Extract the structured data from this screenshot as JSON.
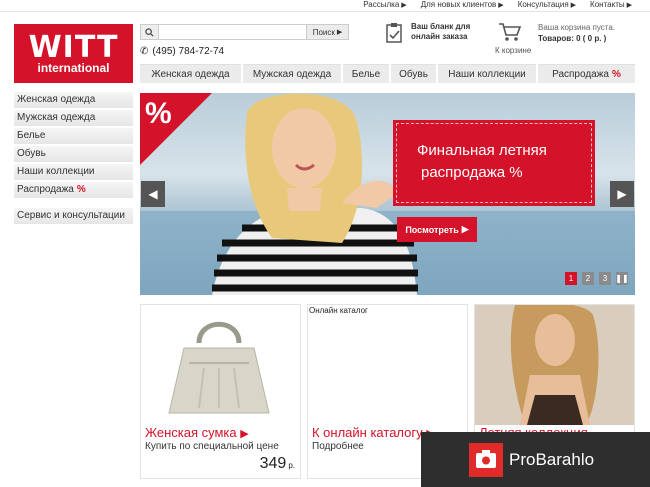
{
  "toplinks": [
    "Рассылка",
    "Для новых клиентов",
    "Консультация",
    "Контакты"
  ],
  "logo": {
    "line1": "WITT",
    "line2": "international"
  },
  "search": {
    "placeholder": "",
    "button": "Поиск"
  },
  "phone": "(495) 784-72-74",
  "order": {
    "line1": "Ваш бланк для",
    "line2": "онлайн заказа"
  },
  "cart": {
    "label": "К корзине",
    "line1": "Ваша корзина пуста.",
    "line2": "Товаров: 0 ( 0 р. )"
  },
  "nav": {
    "tabs": [
      "Женская одежда",
      "Мужская одежда",
      "Белье",
      "Обувь",
      "Наши коллекции",
      "Распродажа"
    ],
    "pct": "%"
  },
  "sidebar": {
    "items": [
      "Женская одежда",
      "Мужская одежда",
      "Белье",
      "Обувь",
      "Наши коллекции",
      "Распродажа"
    ],
    "pct": "%",
    "service": "Сервис и консультации"
  },
  "banner": {
    "corner": "%",
    "promo_line1": "Финальная летняя",
    "promo_line2": "распродажа  %",
    "button": "Посмотреть",
    "pages": [
      "1",
      "2",
      "3"
    ]
  },
  "tiles": [
    {
      "title": "Женская сумка",
      "subtitle": "Купить по специальной цене",
      "price": "349",
      "currency": "р."
    },
    {
      "caption": "Онлайн каталог",
      "title": "К онлайн каталогу",
      "subtitle": "Подробнее"
    },
    {
      "title": "Летняя коллекция"
    }
  ],
  "watermark": "ProBarahlo",
  "colors": {
    "brand": "#d41229"
  }
}
